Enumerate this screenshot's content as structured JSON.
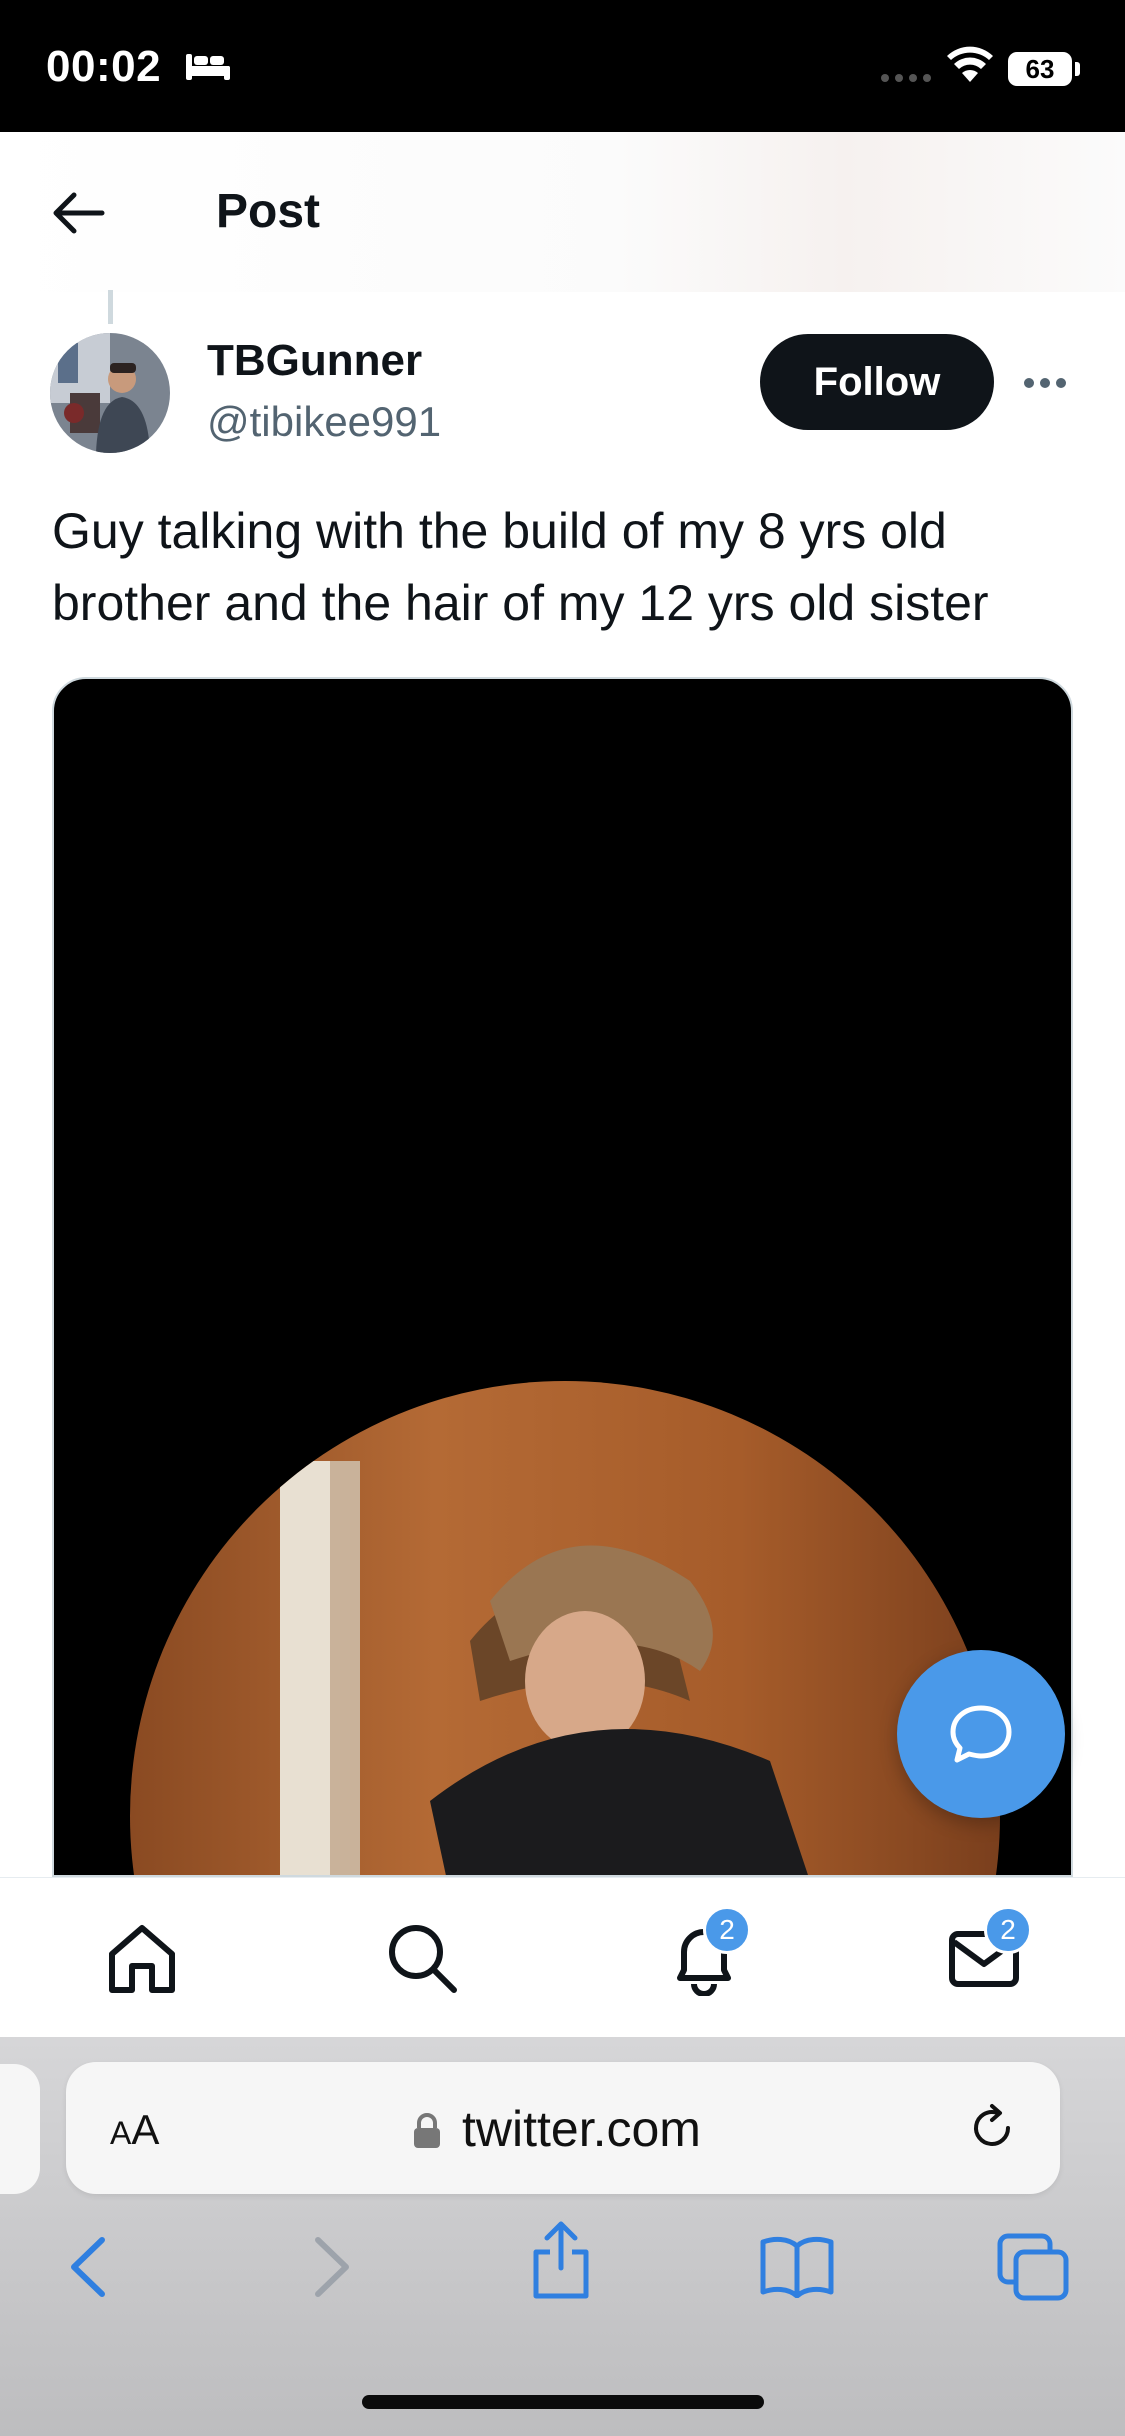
{
  "status_bar": {
    "time": "00:02",
    "battery": "63",
    "icons": [
      "bed-icon",
      "cellular-signal-icon",
      "wifi-icon",
      "battery-icon"
    ]
  },
  "header": {
    "title": "Post",
    "back_icon": "arrow-left-icon"
  },
  "post": {
    "author": {
      "display_name": "TBGunner",
      "handle": "@tibikee991"
    },
    "follow_label": "Follow",
    "more_icon": "ellipsis-icon",
    "text": "Guy talking with the build of my 8 yrs old brother and the hair of my 12 yrs old sister"
  },
  "fab": {
    "icon": "chat-bubble-icon",
    "color": "#4a99e9"
  },
  "tabbar": {
    "items": [
      {
        "name": "home",
        "icon": "home-icon"
      },
      {
        "name": "search",
        "icon": "search-icon"
      },
      {
        "name": "notifications",
        "icon": "bell-icon",
        "badge": "2"
      },
      {
        "name": "messages",
        "icon": "mail-icon",
        "badge": "2"
      }
    ]
  },
  "browser": {
    "aa_label_small": "A",
    "aa_label_large": "A",
    "url": "twitter.com",
    "nav_icons": [
      "chevron-left-icon",
      "chevron-right-icon",
      "share-icon",
      "bookmarks-icon",
      "tabs-icon"
    ],
    "accent": "#2f7fe0"
  }
}
